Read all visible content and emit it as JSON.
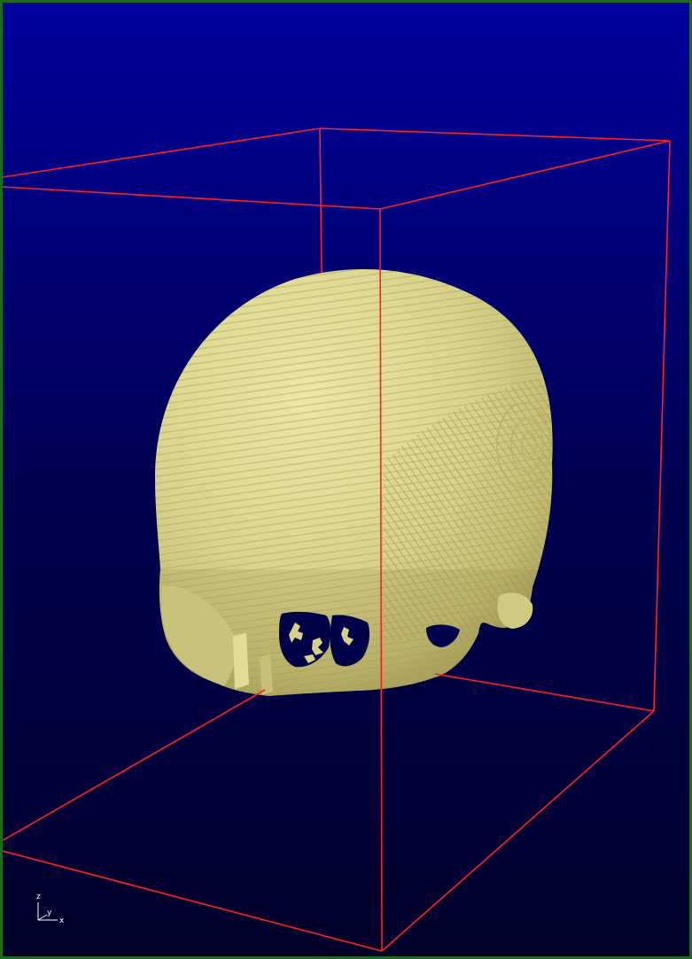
{
  "viewer": {
    "background_top": "#00009e",
    "background_bottom": "#00002a",
    "frame_border_color": "#1d6b1d",
    "bounding_box_color": "#ff2020",
    "surface_color": "#d6d08a",
    "object": "skull-surface-render"
  },
  "orientation_axes": {
    "z_label": "z",
    "y_label": "y",
    "x_label": "x"
  }
}
